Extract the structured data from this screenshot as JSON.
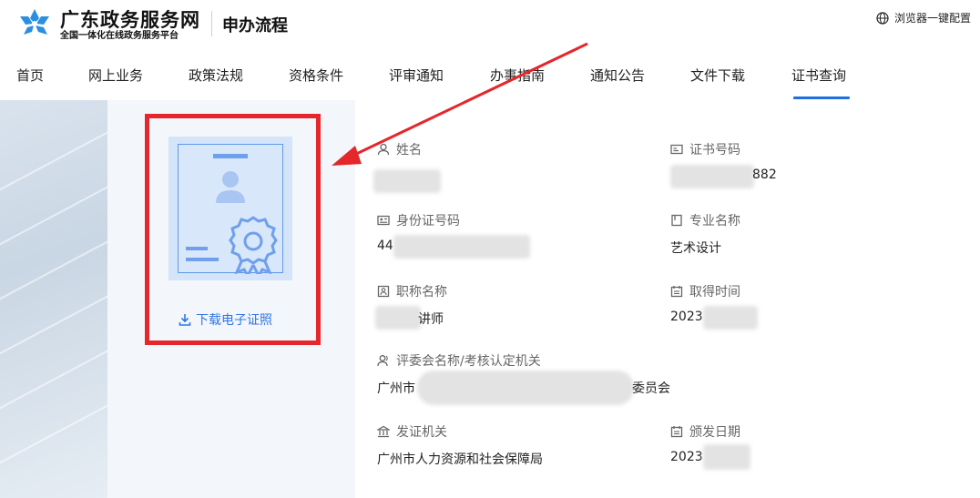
{
  "header": {
    "brand_title": "广东政务服务网",
    "brand_subtitle": "全国一体化在线政务服务平台",
    "section_title": "申办流程",
    "browser_config": "浏览器一键配置"
  },
  "nav": {
    "items": [
      {
        "label": "首页"
      },
      {
        "label": "网上业务"
      },
      {
        "label": "政策法规"
      },
      {
        "label": "资格条件"
      },
      {
        "label": "评审通知"
      },
      {
        "label": "办事指南"
      },
      {
        "label": "通知公告"
      },
      {
        "label": "文件下载"
      },
      {
        "label": "证书查询",
        "active": true
      }
    ]
  },
  "certificate": {
    "download_label": "下载电子证照"
  },
  "fields": {
    "name": {
      "label": "姓名",
      "value": ""
    },
    "cert_no": {
      "label": "证书号码",
      "value": "882"
    },
    "id_no": {
      "label": "身份证号码",
      "value": "44"
    },
    "specialty": {
      "label": "专业名称",
      "value": "艺术设计"
    },
    "title_name": {
      "label": "职称名称",
      "value": "讲师"
    },
    "obtain_time": {
      "label": "取得时间",
      "value": "2023"
    },
    "committee": {
      "label": "评委会名称/考核认定机关",
      "value_prefix": "广州市",
      "value_suffix": "委员会"
    },
    "issuer": {
      "label": "发证机关",
      "value": "广州市人力资源和社会保障局"
    },
    "issue_date": {
      "label": "颁发日期",
      "value": "2023"
    }
  },
  "colors": {
    "accent": "#1f6fe0",
    "highlight_frame": "#e5262b",
    "link": "#2f76e6"
  }
}
